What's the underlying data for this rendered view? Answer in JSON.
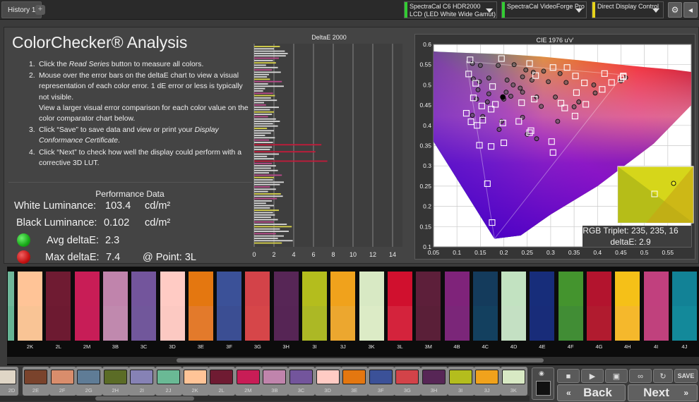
{
  "tabs": {
    "history": "History 1",
    "add": "+"
  },
  "devices": [
    {
      "line1": "SpectraCal C6 HDR2000",
      "line2": "LCD (LED White Wide Gamut)",
      "color": "#33cc33"
    },
    {
      "line1": "SpectraCal VideoForge Pro",
      "line2": "",
      "color": "#33cc33"
    },
    {
      "line1": "Direct Display Control",
      "line2": "",
      "color": "#e6d21a"
    }
  ],
  "title": "ColorChecker® Analysis",
  "steps": [
    {
      "num": "1.",
      "pre": "Click the ",
      "em": "Read Series",
      "post": " button to measure all colors."
    },
    {
      "num": "2.",
      "pre": "Mouse over the error bars on the deltaE chart to view a visual representation of each color error. 1 dE error or less is typically not visible.",
      "em": "",
      "post": "",
      "sub": "View a larger visual error comparison for each color value on the color comparator chart below."
    },
    {
      "num": "3.",
      "pre": "Click “Save” to save data and view or print your ",
      "em": "Display Conformance Certificate",
      "post": "."
    },
    {
      "num": "4.",
      "pre": "Click “Next” to check how well the display could perform with a corrective 3D LUT.",
      "em": "",
      "post": ""
    }
  ],
  "performance": {
    "title": "Performance Data",
    "white_label": "White Luminance:",
    "white_value": "103.4",
    "white_unit": "cd/m²",
    "black_label": "Black Luminance:",
    "black_value": "0.102",
    "black_unit": "cd/m²",
    "avg_label": "Avg deltaE:",
    "avg_value": "2.3",
    "max_label": "Max deltaE:",
    "max_value": "7.4",
    "max_point": "@ Point: 3L",
    "avg_color": "#22b822",
    "max_color": "#c81414"
  },
  "chart_data": [
    {
      "type": "bar",
      "title": "DeltaE 2000",
      "orientation": "horizontal",
      "xlim": [
        0,
        15
      ],
      "xticks": [
        "0",
        "2",
        "4",
        "6",
        "8",
        "10",
        "12",
        "14"
      ],
      "values": [
        2.6,
        2.0,
        3.1,
        3.4,
        3.2,
        2.5,
        1.9,
        2.2,
        1.2,
        2.4,
        1.8,
        2.7,
        1.5,
        1.3,
        1.6,
        2.8,
        1.4,
        3.0,
        1.1,
        0.9,
        1.9,
        2.1,
        1.7,
        2.3,
        1.0,
        1.2,
        2.5,
        1.6,
        2.0,
        1.8,
        1.4,
        2.2,
        2.6,
        1.9,
        2.4,
        1.3,
        2.0,
        1.7,
        1.1,
        2.1,
        1.5,
        1.9,
        6.8,
        1.8,
        1.6,
        6.2,
        2.5,
        1.3,
        2.0,
        7.4,
        1.8,
        2.2,
        1.7,
        2.4,
        1.5,
        2.8,
        2.0,
        1.9,
        3.0,
        2.6,
        1.6,
        2.2,
        1.4,
        2.7,
        2.9,
        2.3,
        1.8,
        1.2,
        2.0,
        1.6,
        2.5,
        1.9,
        2.1,
        1.7,
        2.4,
        2.0,
        3.3,
        3.8,
        2.6,
        3.5,
        2.2,
        3.0,
        2.4,
        3.9,
        2.8
      ]
    },
    {
      "type": "scatter",
      "title": "CIE 1976 u'v'",
      "xlim": [
        0.05,
        0.6
      ],
      "ylim": [
        0.1,
        0.6
      ],
      "xticks": [
        "0.05",
        "0.1",
        "0.15",
        "0.2",
        "0.25",
        "0.3",
        "0.35",
        "0.4",
        "0.45",
        "0.5",
        "0.55"
      ],
      "yticks": [
        "0.1",
        "0.15",
        "0.2",
        "0.25",
        "0.3",
        "0.35",
        "0.4",
        "0.45",
        "0.5",
        "0.55",
        "0.6"
      ],
      "targets_uv": [
        [
          0.128,
          0.562
        ],
        [
          0.195,
          0.565
        ],
        [
          0.255,
          0.553
        ],
        [
          0.335,
          0.543
        ],
        [
          0.415,
          0.528
        ],
        [
          0.455,
          0.52
        ],
        [
          0.125,
          0.527
        ],
        [
          0.14,
          0.504
        ],
        [
          0.176,
          0.496
        ],
        [
          0.268,
          0.523
        ],
        [
          0.305,
          0.543
        ],
        [
          0.353,
          0.522
        ],
        [
          0.372,
          0.505
        ],
        [
          0.43,
          0.506
        ],
        [
          0.135,
          0.468
        ],
        [
          0.153,
          0.448
        ],
        [
          0.182,
          0.452
        ],
        [
          0.238,
          0.456
        ],
        [
          0.265,
          0.465
        ],
        [
          0.322,
          0.455
        ],
        [
          0.33,
          0.443
        ],
        [
          0.375,
          0.452
        ],
        [
          0.12,
          0.43
        ],
        [
          0.13,
          0.409
        ],
        [
          0.155,
          0.413
        ],
        [
          0.173,
          0.44
        ],
        [
          0.198,
          0.406
        ],
        [
          0.232,
          0.41
        ],
        [
          0.258,
          0.387
        ],
        [
          0.352,
          0.423
        ],
        [
          0.355,
          0.481
        ],
        [
          0.41,
          0.489
        ],
        [
          0.143,
          0.4
        ],
        [
          0.148,
          0.351
        ],
        [
          0.173,
          0.348
        ],
        [
          0.2,
          0.357
        ],
        [
          0.255,
          0.382
        ],
        [
          0.302,
          0.36
        ],
        [
          0.305,
          0.333
        ],
        [
          0.165,
          0.256
        ],
        [
          0.175,
          0.16
        ],
        [
          0.455,
          0.522
        ],
        [
          0.45,
          0.515
        ]
      ],
      "measured_uv": [
        [
          0.133,
          0.553
        ],
        [
          0.15,
          0.548
        ],
        [
          0.188,
          0.548
        ],
        [
          0.222,
          0.55
        ],
        [
          0.247,
          0.537
        ],
        [
          0.263,
          0.531
        ],
        [
          0.285,
          0.534
        ],
        [
          0.32,
          0.528
        ],
        [
          0.135,
          0.515
        ],
        [
          0.148,
          0.508
        ],
        [
          0.168,
          0.517
        ],
        [
          0.207,
          0.512
        ],
        [
          0.22,
          0.5
        ],
        [
          0.24,
          0.52
        ],
        [
          0.26,
          0.512
        ],
        [
          0.295,
          0.508
        ],
        [
          0.333,
          0.506
        ],
        [
          0.392,
          0.5
        ],
        [
          0.145,
          0.488
        ],
        [
          0.168,
          0.478
        ],
        [
          0.205,
          0.482
        ],
        [
          0.235,
          0.492
        ],
        [
          0.24,
          0.482
        ],
        [
          0.27,
          0.47
        ],
        [
          0.31,
          0.47
        ],
        [
          0.395,
          0.48
        ],
        [
          0.142,
          0.465
        ],
        [
          0.165,
          0.458
        ],
        [
          0.2,
          0.465
        ],
        [
          0.215,
          0.472
        ],
        [
          0.28,
          0.447
        ],
        [
          0.36,
          0.458
        ],
        [
          0.133,
          0.425
        ],
        [
          0.155,
          0.422
        ],
        [
          0.195,
          0.41
        ],
        [
          0.24,
          0.42
        ],
        [
          0.315,
          0.41
        ],
        [
          0.19,
          0.39
        ],
        [
          0.25,
          0.378
        ],
        [
          0.27,
          0.367
        ],
        [
          0.35,
          0.446
        ],
        [
          0.45,
          0.51
        ],
        [
          0.46,
          0.518
        ]
      ],
      "highlight_uv": [
        0.198,
        0.47
      ],
      "inset": {
        "rgb_label": "RGB Triplet: 235, 235, 16",
        "delta_label": "deltaE: 2.9",
        "target_color": "#e8e82a",
        "measured_color": "#dddd30"
      }
    }
  ],
  "swatches": [
    {
      "label": "",
      "ref": "#6fb79a",
      "meas": "#66b494"
    },
    {
      "label": "2K",
      "ref": "#ffc497",
      "meas": "#f9c495"
    },
    {
      "label": "2L",
      "ref": "#6f1b32",
      "meas": "#6d1a31"
    },
    {
      "label": "2M",
      "ref": "#c81d56",
      "meas": "#c71d57"
    },
    {
      "label": "3B",
      "ref": "#c084ac",
      "meas": "#c089ae"
    },
    {
      "label": "3C",
      "ref": "#73559c",
      "meas": "#71579b"
    },
    {
      "label": "3D",
      "ref": "#ffcbc4",
      "meas": "#fcc9c2"
    },
    {
      "label": "3E",
      "ref": "#e47710",
      "meas": "#e37a2b"
    },
    {
      "label": "3F",
      "ref": "#3b5198",
      "meas": "#3b4e93"
    },
    {
      "label": "3G",
      "ref": "#d34349",
      "meas": "#d64649"
    },
    {
      "label": "3H",
      "ref": "#572656",
      "meas": "#562555"
    },
    {
      "label": "3I",
      "ref": "#b4bd1d",
      "meas": "#acb825"
    },
    {
      "label": "3J",
      "ref": "#f0a21c",
      "meas": "#eca72f"
    },
    {
      "label": "3K",
      "ref": "#d8e9c4",
      "meas": "#dcebc6"
    },
    {
      "label": "3L",
      "ref": "#d0102e",
      "meas": "#d4233c"
    },
    {
      "label": "3M",
      "ref": "#5d1f3a",
      "meas": "#5a1f38"
    },
    {
      "label": "4B",
      "ref": "#7f237a",
      "meas": "#7b2679"
    },
    {
      "label": "4C",
      "ref": "#143b5c",
      "meas": "#13405f"
    },
    {
      "label": "4D",
      "ref": "#c2e2c1",
      "meas": "#c4e0c3"
    },
    {
      "label": "4E",
      "ref": "#172d7a",
      "meas": "#182c79"
    },
    {
      "label": "4F",
      "ref": "#44942e",
      "meas": "#418d35"
    },
    {
      "label": "4G",
      "ref": "#b3142e",
      "meas": "#b11b2f"
    },
    {
      "label": "4H",
      "ref": "#f5c018",
      "meas": "#f5b82c"
    },
    {
      "label": "4I",
      "ref": "#c1407e",
      "meas": "#c0417d"
    },
    {
      "label": "4J",
      "ref": "#128296",
      "meas": "#13899a"
    }
  ],
  "thumbs": [
    {
      "label": "2D",
      "color": "#e0d6c6"
    },
    {
      "label": "2E",
      "color": "#7a432c"
    },
    {
      "label": "2F",
      "color": "#d98d6c"
    },
    {
      "label": "2G",
      "color": "#5f7c96"
    },
    {
      "label": "2H",
      "color": "#5b6c26"
    },
    {
      "label": "2I",
      "color": "#8682b5"
    },
    {
      "label": "2J",
      "color": "#6ab995"
    },
    {
      "label": "2K",
      "color": "#ffc497"
    },
    {
      "label": "2L",
      "color": "#6f1b32"
    },
    {
      "label": "2M",
      "color": "#c81d56"
    },
    {
      "label": "3B",
      "color": "#c084ac"
    },
    {
      "label": "3C",
      "color": "#73559c"
    },
    {
      "label": "3D",
      "color": "#ffcbc4"
    },
    {
      "label": "3E",
      "color": "#e47710"
    },
    {
      "label": "3F",
      "color": "#3b5198"
    },
    {
      "label": "3G",
      "color": "#d34349"
    },
    {
      "label": "3H",
      "color": "#572656"
    },
    {
      "label": "3I",
      "color": "#b4bd1d"
    },
    {
      "label": "3J",
      "color": "#f0a21c"
    },
    {
      "label": "3K",
      "color": "#d8e9c4"
    }
  ],
  "controls": {
    "save": "SAVE",
    "back": "Back",
    "next": "Next"
  }
}
